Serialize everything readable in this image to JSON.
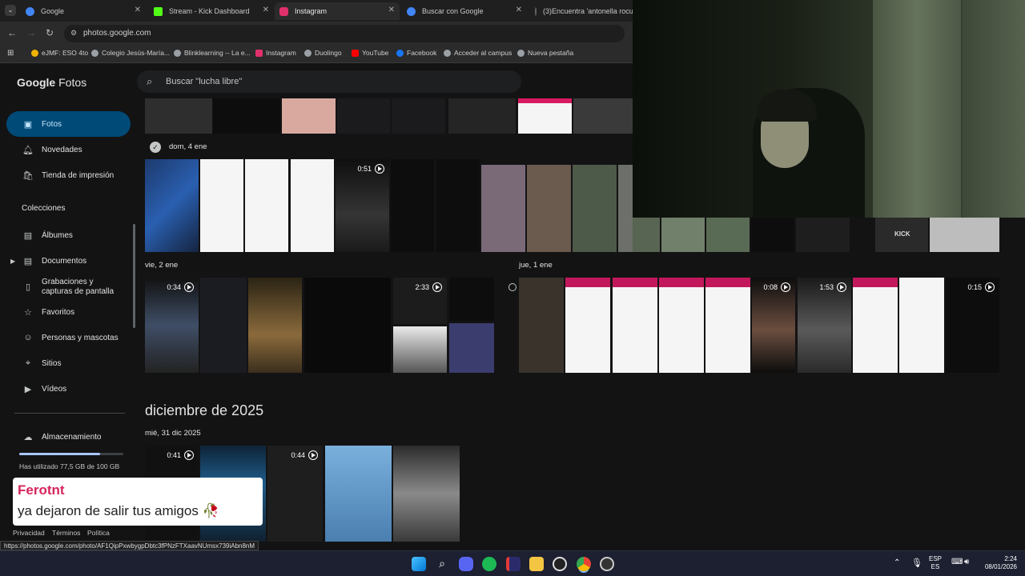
{
  "browser": {
    "tabs": [
      {
        "title": "Google",
        "color": "#4285f4"
      },
      {
        "title": "Stream - Kick Dashboard",
        "color": "#53fc18"
      },
      {
        "title": "Instagram",
        "color": "#e1306c"
      },
      {
        "title": "Buscar con Google",
        "color": "#4285f4"
      },
      {
        "title": "(3)Encuentra 'antonella rocuzz",
        "color": "#000000"
      }
    ],
    "url": "photos.google.com",
    "bookmarks": [
      "eJMF: ESO 4to",
      "Colegio Jesús-María...",
      "Blinklearning -- La e...",
      "Instagram",
      "Duolingo",
      "YouTube",
      "Facebook",
      "Acceder al campus",
      "Nueva pestaña"
    ]
  },
  "app": {
    "logo_google": "Google",
    "logo_fotos": "Fotos",
    "search_placeholder": "Buscar \"lucha libre\""
  },
  "sidebar": {
    "items": [
      {
        "label": "Fotos",
        "icon": "photo-icon",
        "glyph": "▣"
      },
      {
        "label": "Novedades",
        "icon": "bell-icon",
        "glyph": "🔔︎"
      },
      {
        "label": "Tienda de impresión",
        "icon": "shop-icon",
        "glyph": "🛍︎"
      }
    ],
    "collections_title": "Colecciones",
    "collections": [
      {
        "label": "Álbumes",
        "icon": "album-icon",
        "glyph": "▤"
      },
      {
        "label": "Documentos",
        "icon": "document-icon",
        "glyph": "▤"
      },
      {
        "label": "Grabaciones y capturas de pantalla",
        "icon": "screenshot-icon",
        "glyph": "▯"
      },
      {
        "label": "Favoritos",
        "icon": "star-icon",
        "glyph": "☆"
      },
      {
        "label": "Personas y mascotas",
        "icon": "people-icon",
        "glyph": "☺"
      },
      {
        "label": "Sitios",
        "icon": "place-icon",
        "glyph": "⌖"
      },
      {
        "label": "Vídeos",
        "icon": "video-icon",
        "glyph": "▶"
      }
    ],
    "storage_label": "Almacenamiento",
    "storage_text": "Has utilizado 77,5 GB de 100 GB",
    "storage_fraction": 0.775
  },
  "content": {
    "date1": "dom, 4 ene",
    "date2": "vie, 2 ene",
    "date3": "jue, 1 ene",
    "month": "diciembre de 2025",
    "date4": "mié, 31 dic 2025",
    "durations": {
      "d1": "0:51",
      "d2": "0:34",
      "d3": "2:33",
      "d4": "0:08",
      "d5": "1:53",
      "d6": "0:15",
      "d7": "0:41",
      "d8": "0:44"
    }
  },
  "footer": {
    "privacy": "Privacidad",
    "terms": "Términos",
    "policy": "Política"
  },
  "status_url": "https://photos.google.com/photo/AF1QipPxwbygpDbtc3fPNzFTXaavNUmsx739iAbn8nM",
  "chat": {
    "user": "Ferotnt",
    "message": "ya dejaron de salir tus amigos",
    "emoji": "🥀"
  },
  "taskbar": {
    "lang1": "ESP",
    "lang2": "ES",
    "time": "2:24",
    "date": "08/01/2026"
  }
}
